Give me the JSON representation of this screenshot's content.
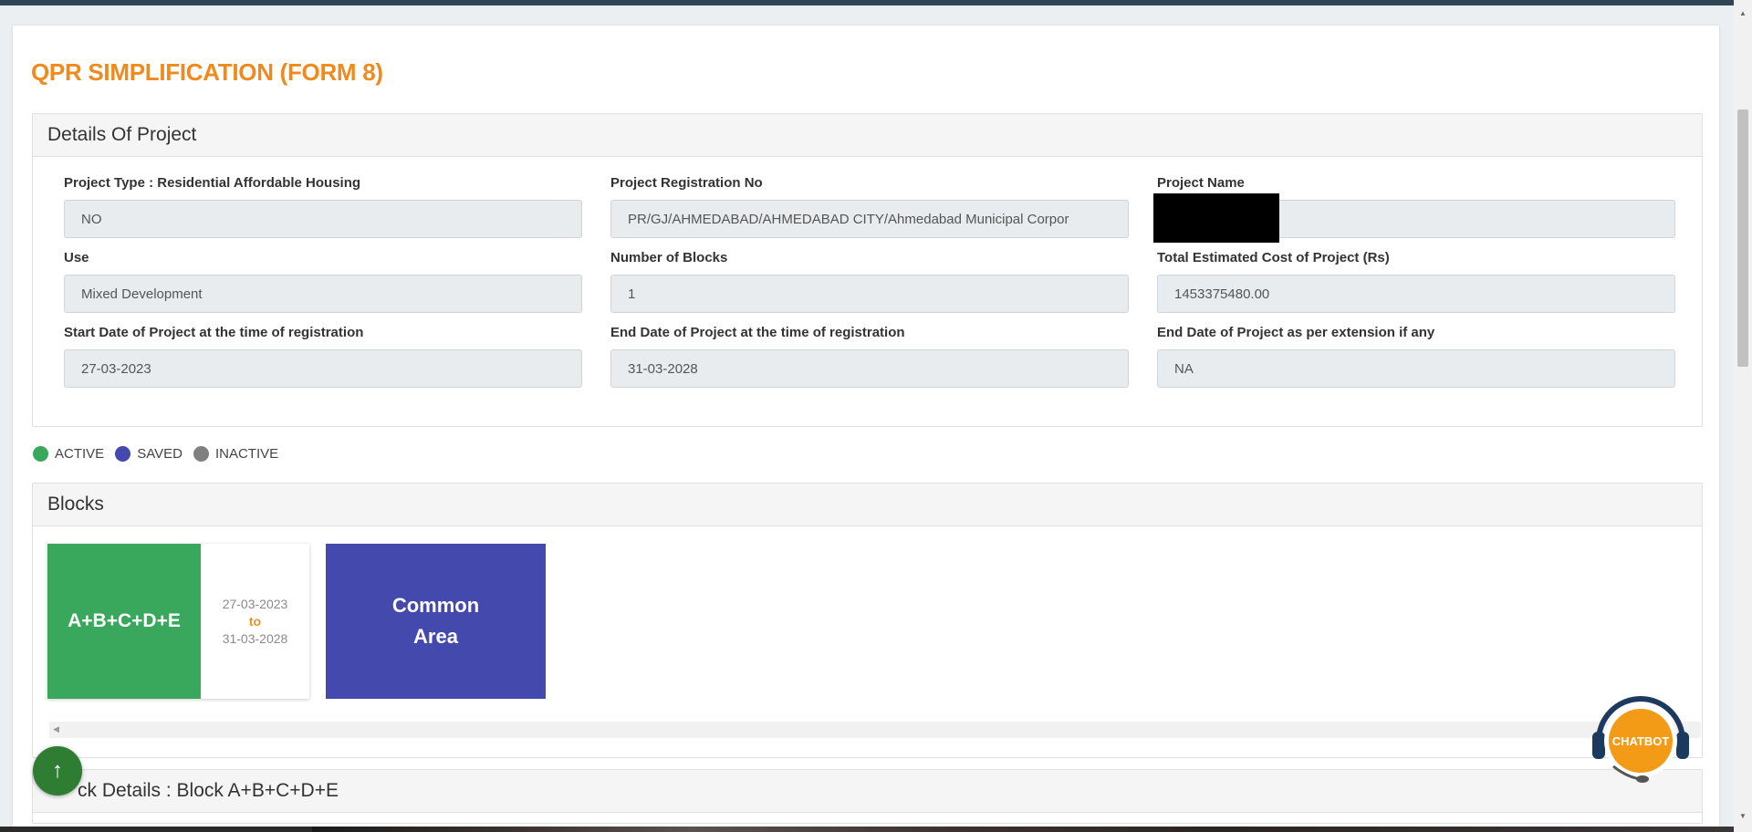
{
  "page": {
    "title": "QPR SIMPLIFICATION (FORM 8)",
    "title_color": "#f08a1c"
  },
  "details": {
    "heading": "Details Of Project",
    "fields": [
      {
        "label": "Project Type : Residential Affordable Housing",
        "value": "NO"
      },
      {
        "label": "Project Registration No",
        "value": "PR/GJ/AHMEDABAD/AHMEDABAD CITY/Ahmedabad Municipal Corpor"
      },
      {
        "label": "Project Name",
        "value": ""
      },
      {
        "label": "Use",
        "value": "Mixed Development"
      },
      {
        "label": "Number of Blocks",
        "value": "1"
      },
      {
        "label": "Total Estimated Cost of Project (Rs)",
        "value": "1453375480.00"
      },
      {
        "label": "Start Date of Project at the time of registration",
        "value": "27-03-2023"
      },
      {
        "label": "End Date of Project at the time of registration",
        "value": "31-03-2028"
      },
      {
        "label": "End Date of Project as per extension if any",
        "value": "NA"
      }
    ]
  },
  "legend": {
    "items": [
      {
        "label": "ACTIVE",
        "color": "#3aa85c"
      },
      {
        "label": "SAVED",
        "color": "#4349ad"
      },
      {
        "label": "INACTIVE",
        "color": "#808080"
      }
    ]
  },
  "blocks": {
    "heading": "Blocks",
    "items": [
      {
        "name": "A+B+C+D+E",
        "start": "27-03-2023",
        "to": "to",
        "end": "31-03-2028",
        "status_color": "#3aa85c"
      },
      {
        "name_line1": "Common",
        "name_line2": "Area",
        "status_color": "#4349ad"
      }
    ]
  },
  "block_details": {
    "heading": "ck Details : Block A+B+C+D+E"
  },
  "buttons": {
    "scroll_top_icon": "arrow-up-icon",
    "scroll_top_glyph": "↑",
    "chatbot_label": "CHATBOT"
  }
}
